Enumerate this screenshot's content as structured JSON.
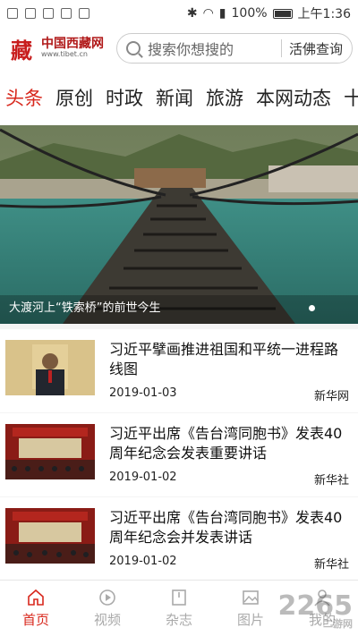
{
  "status_bar": {
    "battery": "100%",
    "time": "上午1:36"
  },
  "header": {
    "logo_cn": "中国西藏网",
    "logo_url": "www.tibet.cn",
    "search_placeholder": "搜索你想搜的",
    "search_button": "活佛查询"
  },
  "tabs": [
    {
      "label": "头条",
      "active": true
    },
    {
      "label": "原创"
    },
    {
      "label": "时政"
    },
    {
      "label": "新闻"
    },
    {
      "label": "旅游"
    },
    {
      "label": "本网动态"
    },
    {
      "label": "十"
    }
  ],
  "hero": {
    "caption": "大渡河上“铁索桥”的前世今生"
  },
  "news": [
    {
      "title": "习近平擘画推进祖国和平统一进程路线图",
      "date": "2019-01-03",
      "source": "新华网"
    },
    {
      "title": "习近平出席《告台湾同胞书》发表40周年纪念会发表重要讲话",
      "date": "2019-01-02",
      "source": "新华社"
    },
    {
      "title": "习近平出席《告台湾同胞书》发表40周年纪念会并发表讲话",
      "date": "2019-01-02",
      "source": "新华社"
    }
  ],
  "bottom_nav": [
    {
      "label": "首页",
      "icon": "home-icon",
      "active": true
    },
    {
      "label": "视频",
      "icon": "play-icon"
    },
    {
      "label": "杂志",
      "icon": "magazine-icon"
    },
    {
      "label": "图片",
      "icon": "image-icon"
    },
    {
      "label": "我的",
      "icon": "user-icon"
    }
  ],
  "watermark": {
    "text": "2265",
    "sub": "二游网"
  },
  "colors": {
    "accent": "#d8281d"
  }
}
